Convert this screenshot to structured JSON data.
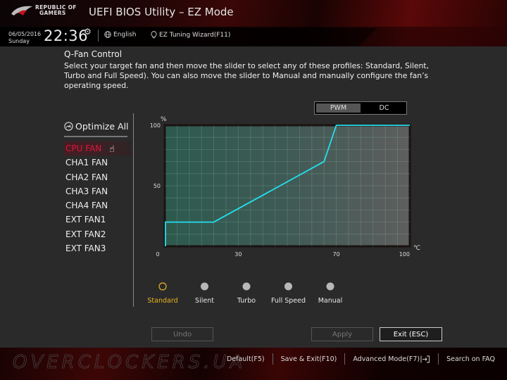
{
  "header": {
    "brand_line1": "REPUBLIC OF",
    "brand_line2": "GAMERS",
    "title": "UEFI BIOS Utility – EZ Mode",
    "date": "06/05/2016",
    "day": "Sunday",
    "time": "22:36",
    "settings_icon": "gear-icon",
    "language_icon": "globe-icon",
    "language": "English",
    "wizard_icon": "lightbulb-icon",
    "wizard": "EZ Tuning Wizard(F11)"
  },
  "section": {
    "title": "Q-Fan Control",
    "description": "Select your target fan and then move the slider to select any of these profiles: Standard, Silent, Turbo and Full Speed). You can also move the slider to Manual and manually configure the fan’s operating speed."
  },
  "fan_panel": {
    "optimize_icon": "gauge-icon",
    "optimize_label": "Optimize All",
    "fans": [
      {
        "label": "CPU FAN",
        "active": true
      },
      {
        "label": "CHA1 FAN",
        "active": false
      },
      {
        "label": "CHA2 FAN",
        "active": false
      },
      {
        "label": "CHA3 FAN",
        "active": false
      },
      {
        "label": "CHA4 FAN",
        "active": false
      },
      {
        "label": "EXT FAN1",
        "active": false
      },
      {
        "label": "EXT FAN2",
        "active": false
      },
      {
        "label": "EXT FAN3",
        "active": false
      }
    ]
  },
  "mode_toggle": {
    "options": [
      "PWM",
      "DC"
    ],
    "selected": "PWM"
  },
  "chart_data": {
    "type": "line",
    "title": "",
    "xlabel": "℃",
    "ylabel": "%",
    "xlim": [
      0,
      100
    ],
    "ylim": [
      0,
      100
    ],
    "x_ticks": [
      0,
      30,
      70,
      100
    ],
    "y_ticks": [
      50,
      100
    ],
    "grid": true,
    "series": [
      {
        "name": "CPU FAN curve",
        "color": "#22e0ee",
        "points": [
          [
            0,
            0
          ],
          [
            0,
            20
          ],
          [
            20,
            20
          ],
          [
            65,
            70
          ],
          [
            70,
            100
          ],
          [
            100,
            100
          ]
        ]
      }
    ]
  },
  "profiles": {
    "options": [
      "Standard",
      "Silent",
      "Turbo",
      "Full Speed",
      "Manual"
    ],
    "selected": "Standard",
    "selected_color": "#e8b320"
  },
  "buttons": {
    "undo": "Undo",
    "apply": "Apply",
    "exit": "Exit (ESC)"
  },
  "footer": {
    "watermark": "OVERCLOCKERS.UA",
    "links": [
      "Default(F5)",
      "Save & Exit(F10)",
      "Advanced Mode(F7)",
      "Search on FAQ"
    ],
    "advanced_icon": "enter-arrow-icon"
  },
  "colors": {
    "accent_red": "#e1143c",
    "curve": "#22e0ee",
    "selected_profile": "#e8b320"
  }
}
